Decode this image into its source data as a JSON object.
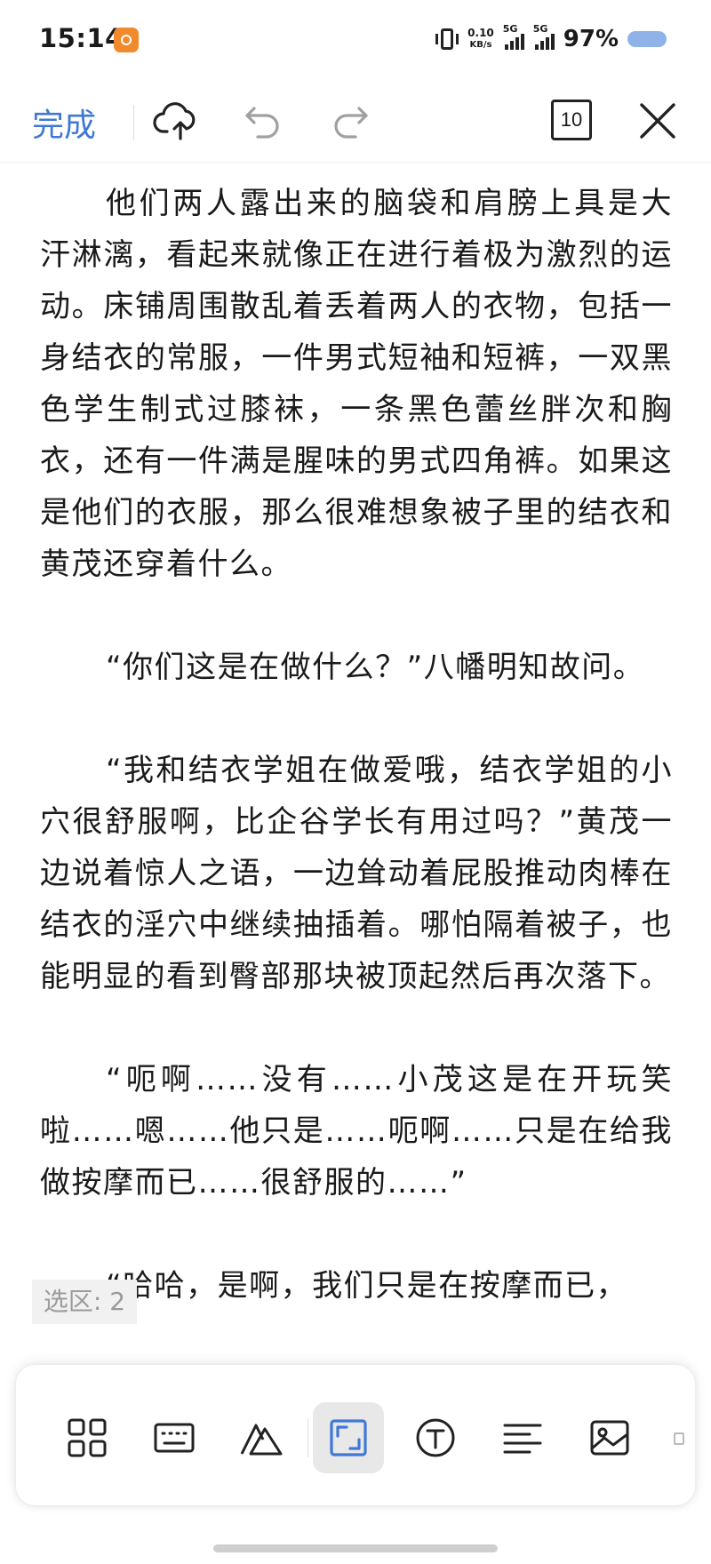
{
  "status": {
    "time": "15:14",
    "net_speed": "0.10",
    "net_unit": "KB/s",
    "sim1": "5G",
    "sim2": "5G",
    "battery": "97%"
  },
  "toolbar": {
    "done_label": "完成",
    "page_count": "10"
  },
  "document": {
    "paragraphs": [
      "他们两人露出来的脑袋和肩膀上具是大汗淋漓，看起来就像正在进行着极为激烈的运动。床铺周围散乱着丢着两人的衣物，包括一身结衣的常服，一件男式短袖和短裤，一双黑色学生制式过膝袜，一条黑色蕾丝胖次和胸衣，还有一件满是腥味的男式四角裤。如果这是他们的衣服，那么很难想象被子里的结衣和黄茂还穿着什么。",
      "“你们这是在做什么？”八幡明知故问。",
      "“我和结衣学姐在做爱哦，结衣学姐的小穴很舒服啊，比企谷学长有用过吗？”黄茂一边说着惊人之语，一边耸动着屁股推动肉棒在结衣的淫穴中继续抽插着。哪怕隔着被子，也能明显的看到臀部那块被顶起然后再次落下。",
      "“呃啊……没有……小茂这是在开玩笑啦……嗯……他只是……呃啊……只是在给我做按摩而已……很舒服的……”",
      "“哈哈，是啊，我们只是在按摩而已，"
    ]
  },
  "selection": {
    "label": "选区: 2"
  },
  "bottom_tools": [
    {
      "name": "apps-grid-icon",
      "active": false
    },
    {
      "name": "keyboard-icon",
      "active": false
    },
    {
      "name": "font-style-icon",
      "active": false
    },
    {
      "name": "selection-frame-icon",
      "active": true
    },
    {
      "name": "text-circle-icon",
      "active": false
    },
    {
      "name": "align-paragraph-icon",
      "active": false
    },
    {
      "name": "image-icon",
      "active": false
    }
  ],
  "colors": {
    "accent": "#3f78d6",
    "battery": "#8fb3e8",
    "active_tool_bg": "#e8e8e8"
  }
}
